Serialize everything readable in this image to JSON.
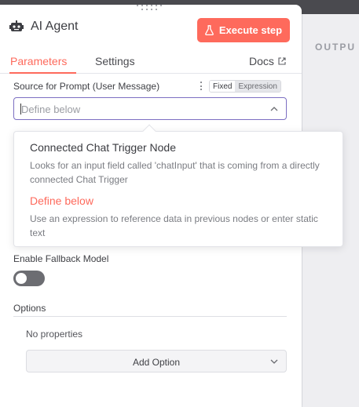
{
  "header": {
    "title": "AI Agent",
    "icon": "robot-icon",
    "execute_label": "Execute step"
  },
  "tabs": {
    "parameters": "Parameters",
    "settings": "Settings",
    "docs": "Docs"
  },
  "prompt_source": {
    "label": "Source for Prompt (User Message)",
    "mode_fixed": "Fixed",
    "mode_expression": "Expression",
    "selected_value": "Define below"
  },
  "dropdown": {
    "options": [
      {
        "title": "Connected Chat Trigger Node",
        "description": "Looks for an input field called 'chatInput' that is coming from a directly connected Chat Trigger"
      },
      {
        "title": "Define below",
        "description": "Use an expression to reference data in previous nodes or enter static text",
        "selected": true
      }
    ]
  },
  "fallback": {
    "label": "Enable Fallback Model",
    "enabled": false
  },
  "options": {
    "label": "Options",
    "empty_text": "No properties",
    "add_label": "Add Option"
  },
  "output_panel": {
    "label": "OUTPU"
  },
  "colors": {
    "accent": "#fe6a5c",
    "focus_border": "#7c6fc2"
  }
}
